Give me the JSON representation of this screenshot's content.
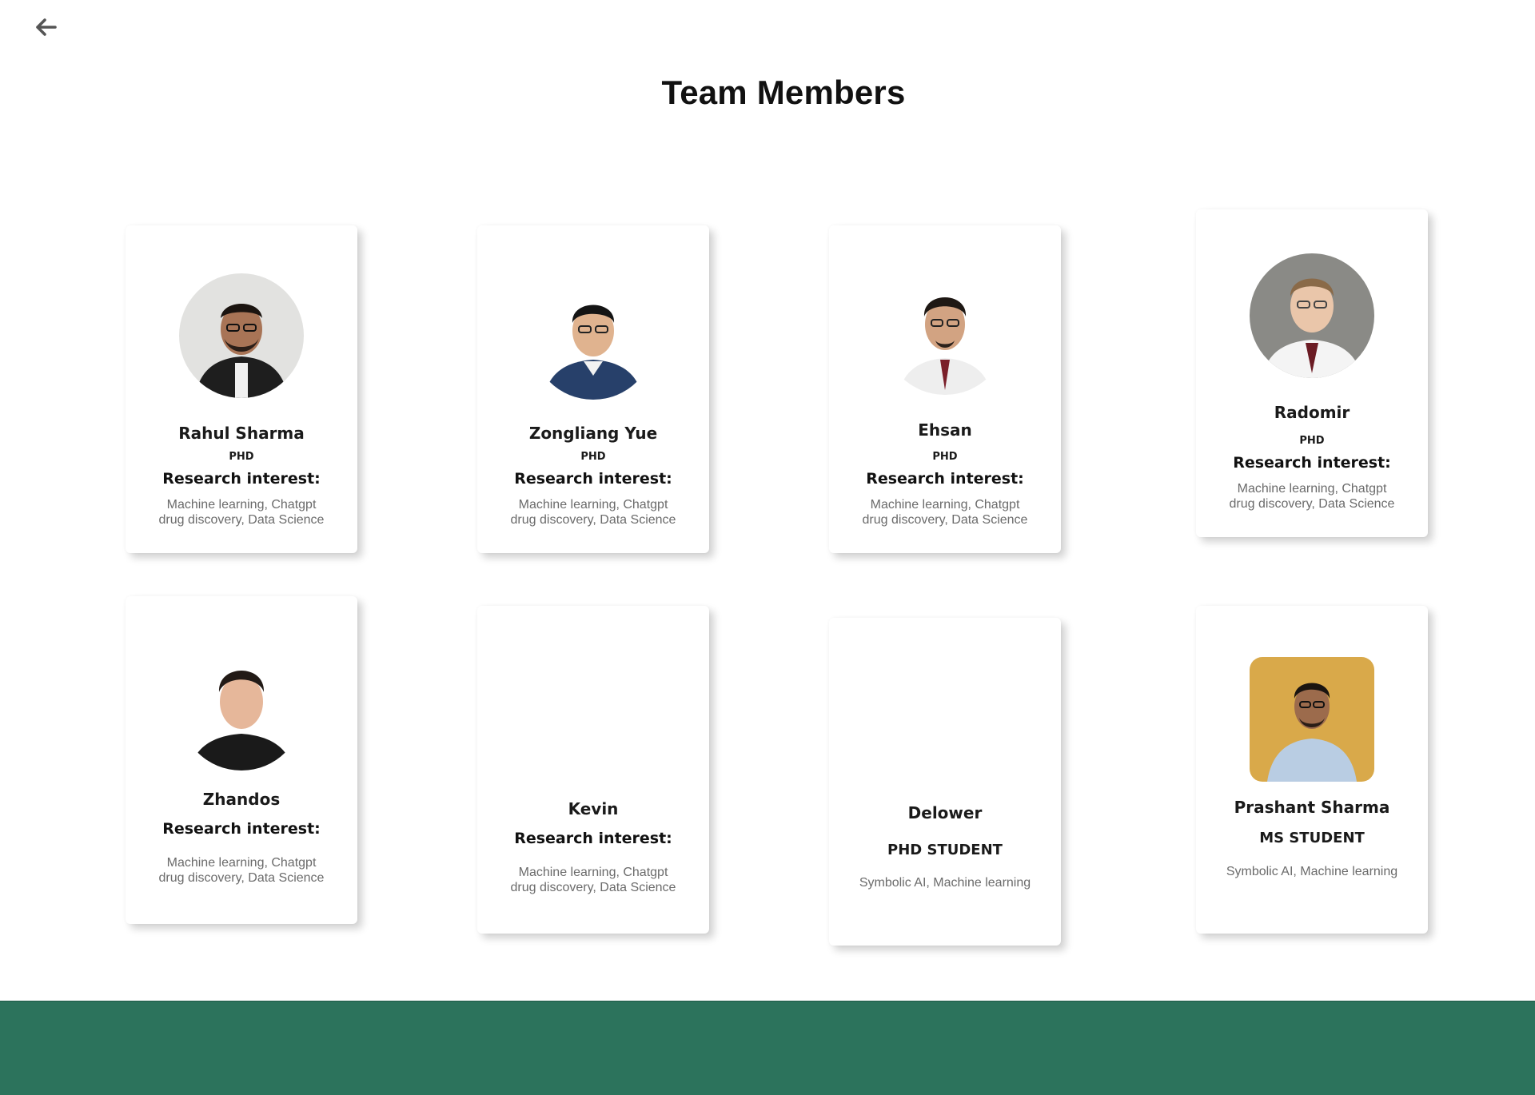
{
  "header": {
    "back_icon": "arrow-left-icon",
    "title": "Team Members"
  },
  "members": [
    {
      "name": "Rahul Sharma",
      "degree": "PHD",
      "research_label": "Research interest:",
      "research_line1": "Machine learning, Chatgpt",
      "research_line2": "drug discovery, Data Science"
    },
    {
      "name": "Zongliang Yue",
      "degree": "PHD",
      "research_label": "Research interest:",
      "research_line1": "Machine learning, Chatgpt",
      "research_line2": "drug discovery, Data Science"
    },
    {
      "name": "Ehsan",
      "degree": "PHD",
      "research_label": "Research interest:",
      "research_line1": "Machine learning, Chatgpt",
      "research_line2": "drug discovery, Data Science"
    },
    {
      "name": "Radomir",
      "degree": "PHD",
      "research_label": "Research interest:",
      "research_line1": "Machine learning, Chatgpt",
      "research_line2": "drug discovery, Data Science"
    },
    {
      "name": "Zhandos",
      "research_label": "Research interest:",
      "research_line1": "Machine learning, Chatgpt",
      "research_line2": "drug discovery, Data Science"
    },
    {
      "name": "Kevin",
      "research_label": "Research interest:",
      "research_line1": "Machine learning, Chatgpt",
      "research_line2": "drug discovery, Data Science"
    },
    {
      "name": "Delower",
      "degree": "PHD STUDENT",
      "research_line1": "Symbolic AI, Machine learning"
    },
    {
      "name": "Prashant Sharma",
      "degree": "MS STUDENT",
      "research_line1": "Symbolic AI, Machine learning"
    }
  ],
  "colors": {
    "footer": "#2c735c",
    "body_text": "#1a1a1a",
    "muted_text": "#6b6b6b"
  }
}
